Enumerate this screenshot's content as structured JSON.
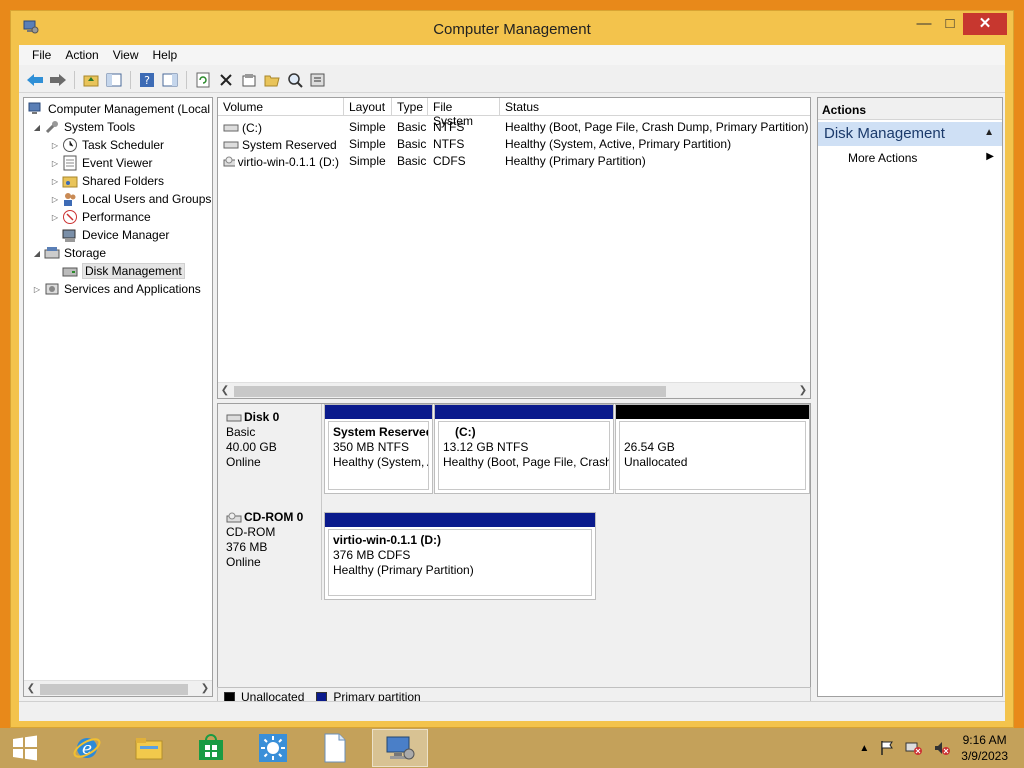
{
  "window": {
    "title": "Computer Management"
  },
  "menu": [
    "File",
    "Action",
    "View",
    "Help"
  ],
  "tree": {
    "root": "Computer Management (Local",
    "system_tools": "System Tools",
    "task_scheduler": "Task Scheduler",
    "event_viewer": "Event Viewer",
    "shared_folders": "Shared Folders",
    "local_users": "Local Users and Groups",
    "performance": "Performance",
    "device_manager": "Device Manager",
    "storage": "Storage",
    "disk_management": "Disk Management",
    "services": "Services and Applications"
  },
  "volumes": {
    "columns": [
      "Volume",
      "Layout",
      "Type",
      "File System",
      "Status"
    ],
    "rows": [
      [
        "(C:)",
        "Simple",
        "Basic",
        "NTFS",
        "Healthy (Boot, Page File, Crash Dump, Primary Partition)"
      ],
      [
        "System Reserved",
        "Simple",
        "Basic",
        "NTFS",
        "Healthy (System, Active, Primary Partition)"
      ],
      [
        "virtio-win-0.1.1 (D:)",
        "Simple",
        "Basic",
        "CDFS",
        "Healthy (Primary Partition)"
      ]
    ]
  },
  "disks": {
    "disk0": {
      "name": "Disk 0",
      "type": "Basic",
      "size": "40.00 GB",
      "state": "Online"
    },
    "cdrom0": {
      "name": "CD-ROM 0",
      "type": "CD-ROM",
      "size": "376 MB",
      "state": "Online"
    }
  },
  "partitions": {
    "sysres": {
      "name": "System Reserved",
      "size": "350 MB NTFS",
      "status": "Healthy (System, A"
    },
    "c": {
      "name": "(C:)",
      "size": "13.12 GB NTFS",
      "status": "Healthy (Boot, Page File, Crash"
    },
    "unalloc": {
      "size": "26.54 GB",
      "status": "Unallocated"
    },
    "d": {
      "name": "virtio-win-0.1.1  (D:)",
      "size": "376 MB CDFS",
      "status": "Healthy (Primary Partition)"
    }
  },
  "legend": {
    "unallocated": "Unallocated",
    "primary": "Primary partition"
  },
  "actions": {
    "header": "Actions",
    "section": "Disk Management",
    "more": "More Actions"
  },
  "clock": {
    "time": "9:16 AM",
    "date": "3/9/2023"
  },
  "colors": {
    "primary": "#0a1a8c",
    "unallocated": "#000000",
    "desktop": "#e8891a"
  }
}
